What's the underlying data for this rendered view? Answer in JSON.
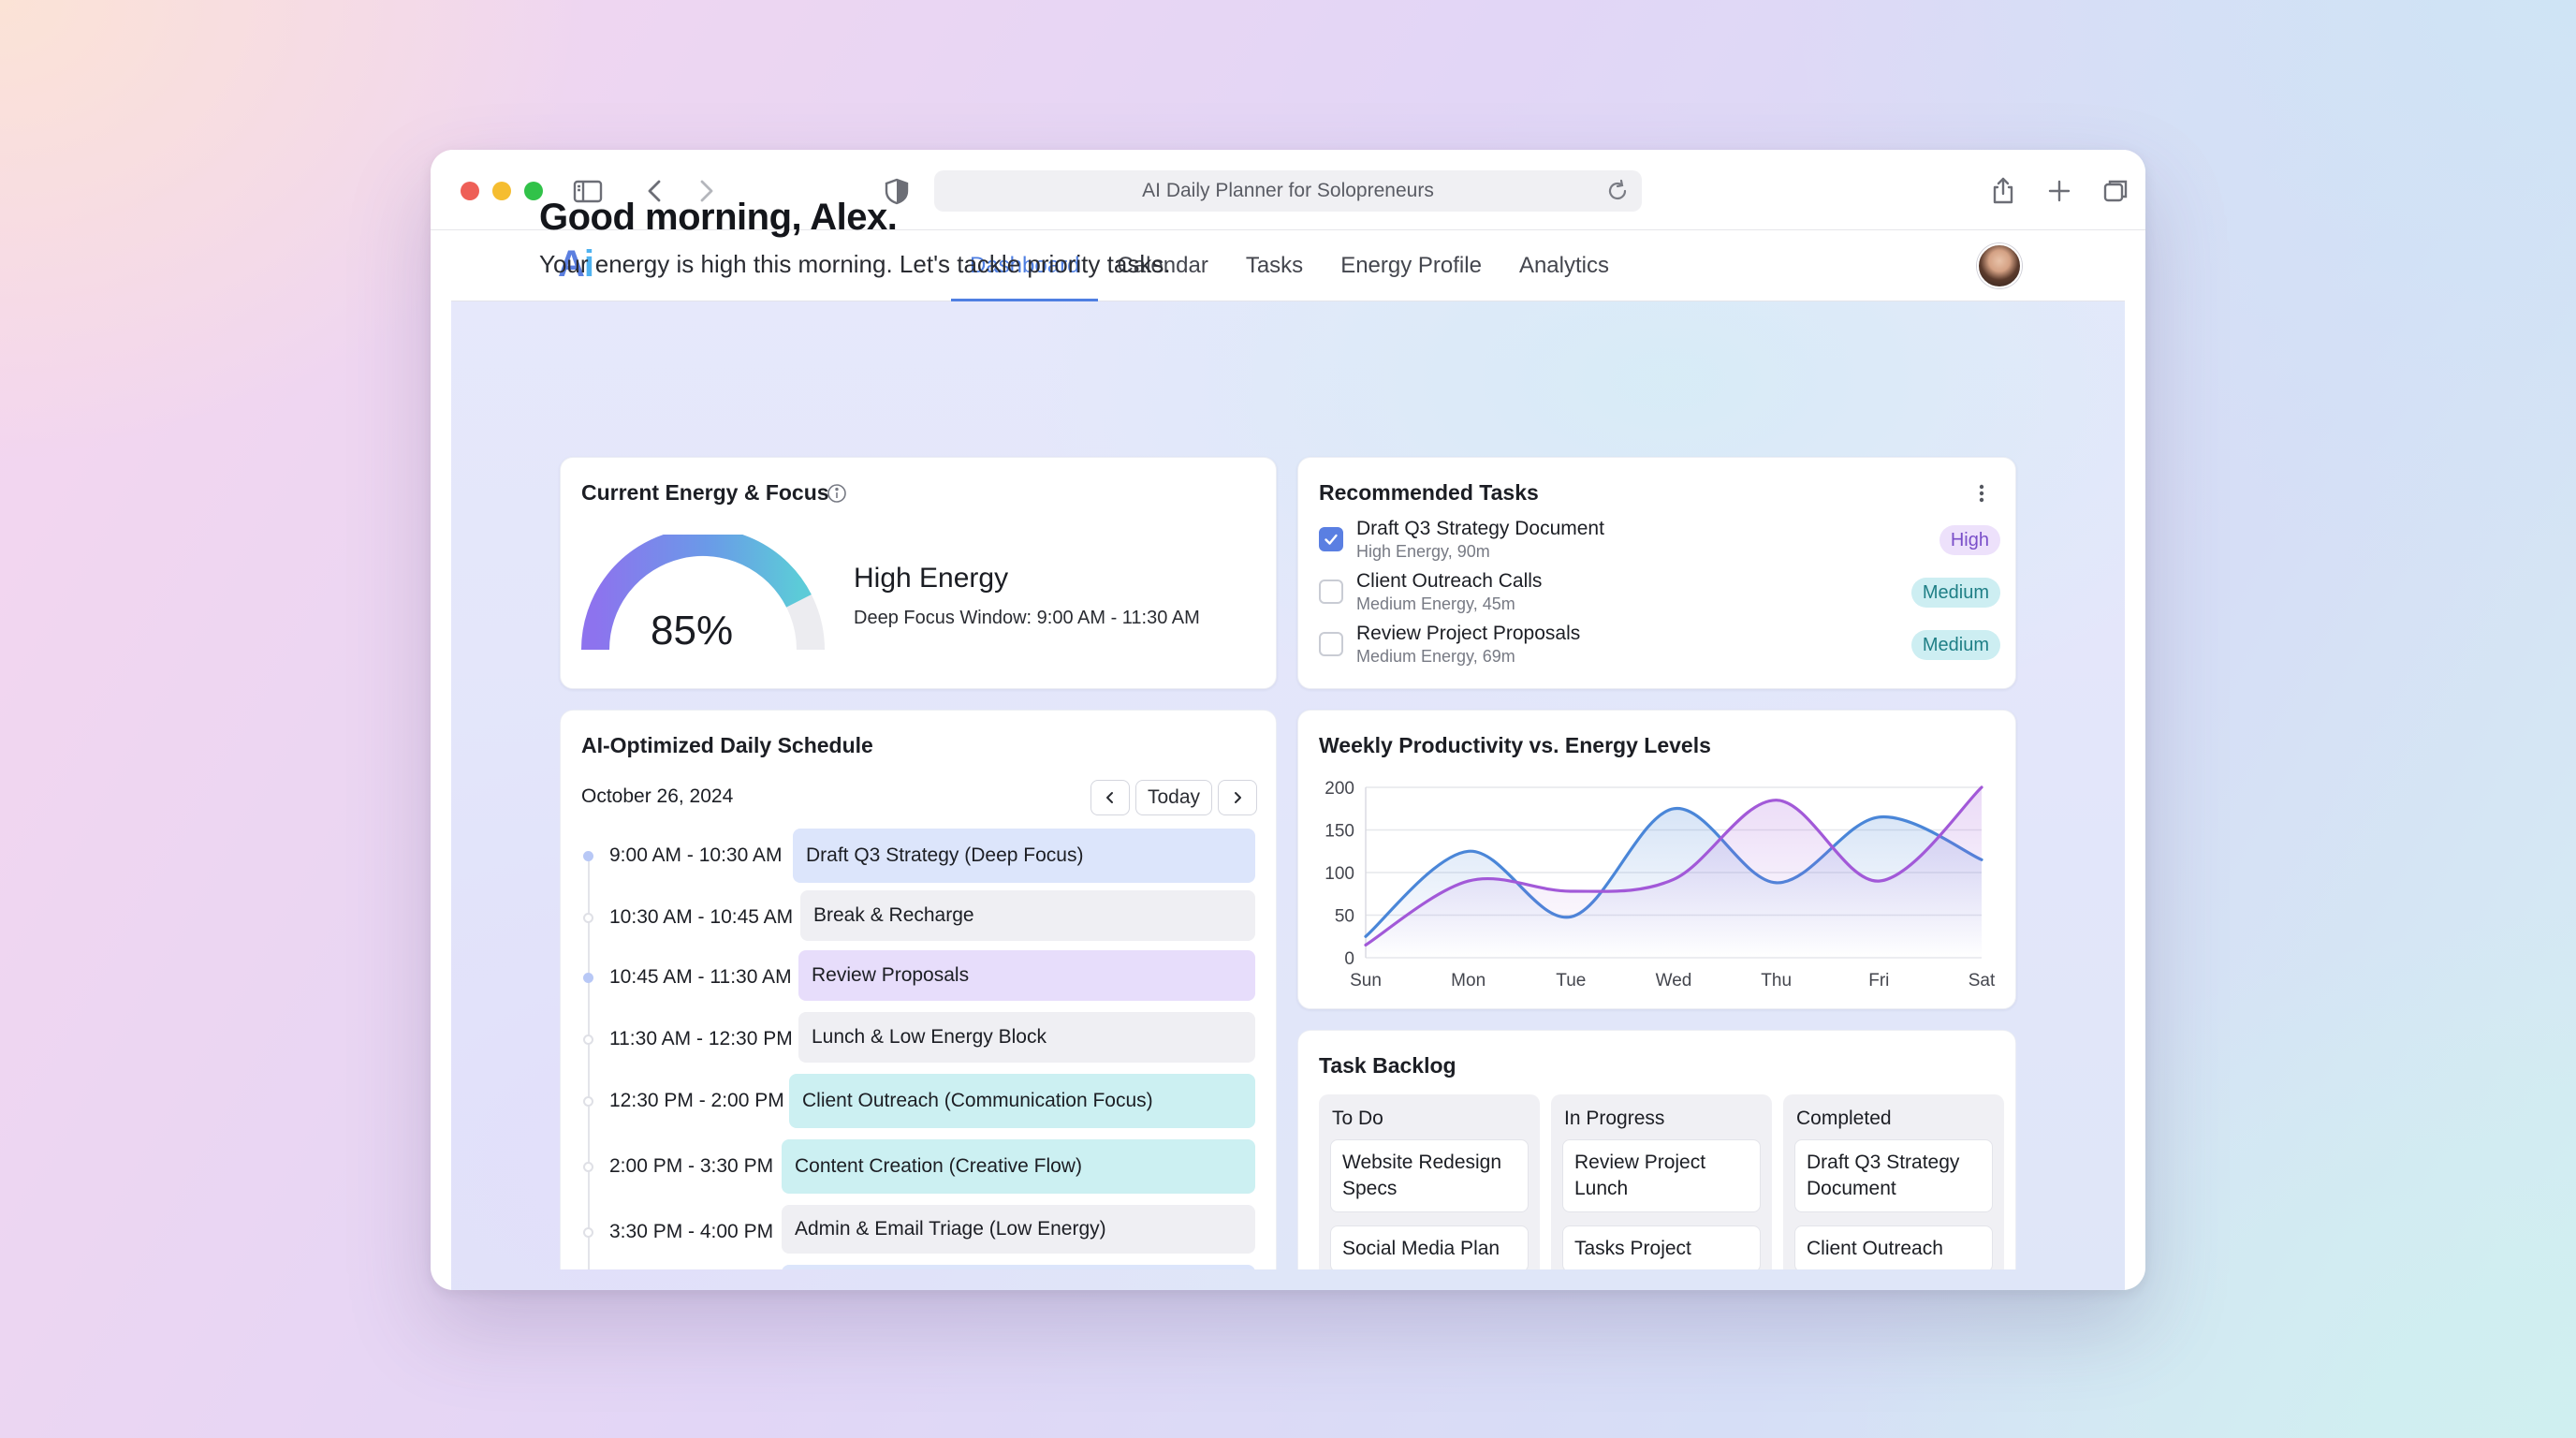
{
  "browser": {
    "url_title": "AI Daily Planner for Solopreneurs"
  },
  "nav": {
    "logo_a": "A",
    "logo_i": "i",
    "tabs": [
      {
        "label": "Dashboard",
        "active": true
      },
      {
        "label": "Calendar",
        "active": false
      },
      {
        "label": "Tasks",
        "active": false
      },
      {
        "label": "Energy Profile",
        "active": false
      },
      {
        "label": "Analytics",
        "active": false
      }
    ]
  },
  "greeting": {
    "title": "Good morning, Alex.",
    "subtitle": "Your energy is high this morning. Let's tackle priority tasks."
  },
  "energy": {
    "title": "Current Energy & Focus",
    "percent": 85,
    "value_text": "85%",
    "level": "High Energy",
    "window": "Deep Focus Window: 9:00 AM - 11:30 AM"
  },
  "recommended": {
    "title": "Recommended Tasks",
    "tasks": [
      {
        "name": "Draft Q3 Strategy Document",
        "meta": "High Energy, 90m",
        "badge": "High",
        "checked": true
      },
      {
        "name": "Client Outreach Calls",
        "meta": "Medium Energy, 45m",
        "badge": "Medium",
        "checked": false
      },
      {
        "name": "Review Project Proposals",
        "meta": "Medium Energy, 69m",
        "badge": "Medium",
        "checked": false
      }
    ]
  },
  "schedule": {
    "title": "AI-Optimized Daily Schedule",
    "date": "October 26, 2024",
    "today_label": "Today",
    "slots": [
      {
        "time": "9:00 AM - 10:30 AM",
        "label": "Draft Q3 Strategy (Deep Focus)"
      },
      {
        "time": "10:30 AM - 10:45 AM",
        "label": "Break & Recharge"
      },
      {
        "time": "10:45 AM - 11:30 AM",
        "label": "Review Proposals"
      },
      {
        "time": "11:30 AM - 12:30 PM",
        "label": "Lunch & Low Energy Block"
      },
      {
        "time": "12:30 PM - 2:00 PM",
        "label": "Client Outreach (Communication Focus)"
      },
      {
        "time": "2:00 PM - 3:30 PM",
        "label": "Content Creation (Creative Flow)"
      },
      {
        "time": "3:30 PM - 4:00 PM",
        "label": "Admin & Email Triage (Low Energy)"
      }
    ]
  },
  "chart_data": {
    "type": "line",
    "title": "Weekly Productivity vs. Energy Levels",
    "categories": [
      "Sun",
      "Mon",
      "Tue",
      "Wed",
      "Thu",
      "Fri",
      "Sat"
    ],
    "ylim": [
      0,
      200
    ],
    "yticks": [
      0,
      50,
      100,
      150,
      200
    ],
    "grid": true,
    "series": [
      {
        "color": "#4a86d8",
        "values": [
          25,
          125,
          48,
          175,
          88,
          165,
          115
        ]
      },
      {
        "color": "#a259d8",
        "values": [
          15,
          90,
          78,
          92,
          185,
          90,
          200
        ]
      }
    ]
  },
  "backlog": {
    "title": "Task Backlog",
    "columns": [
      {
        "title": "To Do",
        "cards": [
          "Website Redesign Specs",
          "Social Media Plan"
        ]
      },
      {
        "title": "In Progress",
        "cards": [
          "Review Project Lunch",
          "Tasks Project"
        ]
      },
      {
        "title": "Completed",
        "cards": [
          "Draft Q3 Strategy Document",
          "Client Outreach"
        ]
      }
    ]
  }
}
